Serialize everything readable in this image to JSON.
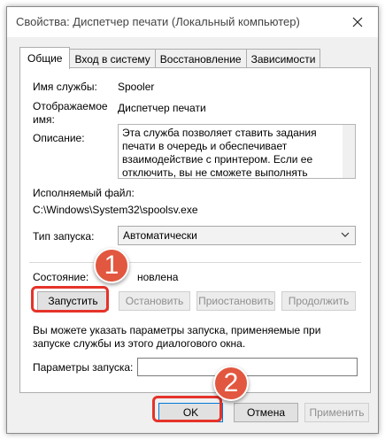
{
  "window": {
    "title": "Свойства: Диспетчер печати (Локальный компьютер)"
  },
  "tabs": [
    {
      "label": "Общие",
      "active": true
    },
    {
      "label": "Вход в систему",
      "active": false
    },
    {
      "label": "Восстановление",
      "active": false
    },
    {
      "label": "Зависимости",
      "active": false
    }
  ],
  "general": {
    "service_name_label": "Имя службы:",
    "service_name_value": "Spooler",
    "display_name_label": "Отображаемое имя:",
    "display_name_value": "Диспетчер печати",
    "description_label": "Описание:",
    "description_value": "Эта служба позволяет ставить задания печати в очередь и обеспечивает взаимодействие с принтером. Если ее отключить, вы не сможете выполнять печать и видеть свои принтеры.",
    "exe_label": "Исполняемый файл:",
    "exe_value": "C:\\Windows\\System32\\spoolsv.exe",
    "startup_label": "Тип запуска:",
    "startup_value": "Автоматически",
    "status_label": "Состояние:",
    "status_value": "новлена",
    "buttons": {
      "start": "Запустить",
      "stop": "Остановить",
      "pause": "Приостановить",
      "resume": "Продолжить"
    },
    "hint": "Вы можете указать параметры запуска, применяемые при запуске службы из этого диалогового окна.",
    "params_label": "Параметры запуска:",
    "params_value": ""
  },
  "footer": {
    "ok": "OK",
    "cancel": "Отмена",
    "apply": "Применить"
  },
  "callouts": {
    "first": "1",
    "second": "2"
  },
  "colors": {
    "callout": "#e2573f",
    "highlight": "#e5332a",
    "accent": "#0078d7"
  }
}
